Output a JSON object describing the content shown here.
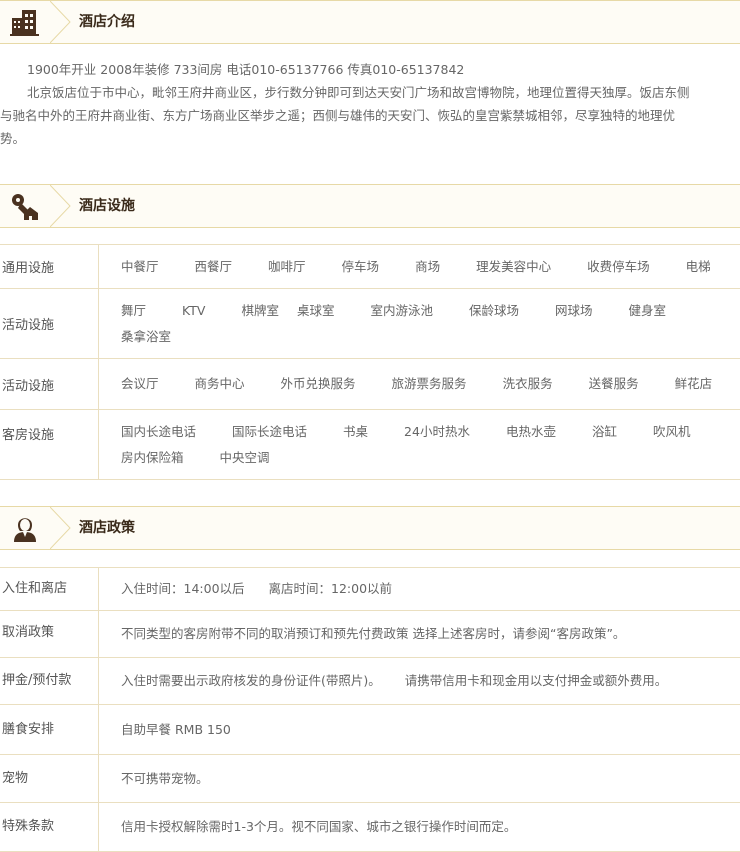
{
  "intro": {
    "header_title": "酒店介绍",
    "icon": "building-icon",
    "line1": "1900年开业  2008年装修  733间房  电话010-65137766 传真010-65137842",
    "line2": "北京饭店位于市中心，毗邻王府井商业区，步行数分钟即可到达天安门广场和故宫博物院，地理位置得天独厚。饭店东侧",
    "line3": "与驰名中外的王府井商业街、东方广场商业区举步之遥；西侧与雄伟的天安门、恢弘的皇宫紫禁城相邻，尽享独特的地理优",
    "line4": "势。"
  },
  "facilities": {
    "header_title": "酒店设施",
    "icon": "key-house-icon",
    "rows": [
      {
        "label": "通用设施",
        "items": [
          "中餐厅",
          "西餐厅",
          "咖啡厅",
          "停车场",
          "商场",
          "理发美容中心",
          "收费停车场",
          "电梯"
        ]
      },
      {
        "label": "活动设施",
        "items": [
          "舞厅",
          "KTV",
          "棋牌室",
          "桌球室",
          "室内游泳池",
          "保龄球场",
          "网球场",
          "健身室",
          "桑拿浴室"
        ]
      },
      {
        "label": "活动设施",
        "items": [
          "会议厅",
          "商务中心",
          "外币兑换服务",
          "旅游票务服务",
          "洗衣服务",
          "送餐服务",
          "鲜花店"
        ]
      },
      {
        "label": "客房设施",
        "items": [
          "国内长途电话",
          "国际长途电话",
          "书桌",
          "24小时热水",
          "电热水壶",
          "浴缸",
          "吹风机",
          "房内保险箱",
          "中央空调"
        ]
      }
    ]
  },
  "policy": {
    "header_title": "酒店政策",
    "icon": "person-icon",
    "checkin": {
      "label": "入住和离店",
      "in": "入住时间：14:00以后",
      "out": "离店时间：12:00以前"
    },
    "cancel": {
      "label": "取消政策",
      "text": "不同类型的客房附带不同的取消预订和预先付费政策 选择上述客房时，请参阅“客房政策”。"
    },
    "deposit": {
      "label": "押金/预付款",
      "text1": "入住时需要出示政府核发的身份证件(带照片)。",
      "text2": "请携带信用卡和现金用以支付押金或额外费用。"
    },
    "meal": {
      "label": "膳食安排",
      "text": "自助早餐 RMB 150"
    },
    "pet": {
      "label": "宠物",
      "text": "不可携带宠物。"
    },
    "special": {
      "label": "特殊条款",
      "text": "信用卡授权解除需时1-3个月。视不同国家、城市之银行操作时间而定。"
    }
  },
  "colors": {
    "accent_border": "#e7d9a6",
    "header_bg": "#fefcf5",
    "icon_brown": "#4a3220",
    "title_dark": "#3a2a1a"
  }
}
